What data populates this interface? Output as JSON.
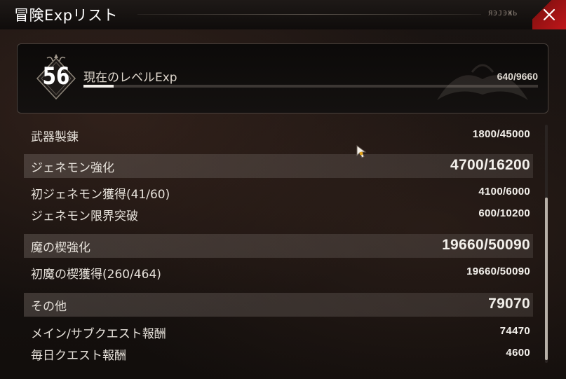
{
  "window": {
    "title": "冒険Expリスト",
    "title_decoration": "ЯЭJЭЖЬ",
    "close_icon": "close-icon",
    "accent_color": "#c0161a"
  },
  "level": {
    "number": "56",
    "label": "現在のレベルExp",
    "value": "640/9660",
    "progress": 0.066
  },
  "rows": [
    {
      "label": "武器製錬",
      "value": "1800/45000",
      "section": false
    },
    {
      "label": "ジェネモン強化",
      "value": "4700/16200",
      "section": true
    },
    {
      "label": "初ジェネモン獲得(41/60)",
      "value": "4100/6000",
      "section": false
    },
    {
      "label": "ジェネモン限界突破",
      "value": "600/10200",
      "section": false
    },
    {
      "label": "魔の楔強化",
      "value": "19660/50090",
      "section": true
    },
    {
      "label": "初魔の楔獲得(260/464)",
      "value": "19660/50090",
      "section": false
    },
    {
      "label": "その他",
      "value": "79070",
      "section": true
    },
    {
      "label": "メイン/サブクエスト報酬",
      "value": "74470",
      "section": false
    },
    {
      "label": "毎日クエスト報酬",
      "value": "4600",
      "section": false
    }
  ]
}
